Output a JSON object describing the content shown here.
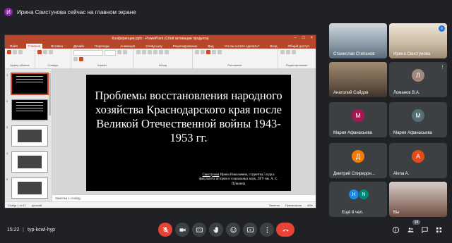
{
  "banner": {
    "avatar_letter": "И",
    "text": "Ирина Свистунова сейчас на главном экране",
    "avatar_color": "#8e24aa"
  },
  "ppt": {
    "window_title": "Конференция.pptx - PowerPoint (Сбой активации продукта)",
    "tabs": [
      "Файл",
      "Главная",
      "Вставка",
      "Дизайн",
      "Переходы",
      "Анимация",
      "Слайд-шоу",
      "Рецензирование",
      "Вид",
      "Что вы хотите сделать?",
      "Вход",
      "Общий доступ"
    ],
    "ribbon_groups": [
      "Буфер обмена",
      "Слайды",
      "Шрифт",
      "Абзац",
      "Рисование",
      "Редактирование"
    ],
    "slide_title": "Проблемы восстановления народного хозяйства Краснодарского края после Великой Отечественной войны 1943-1953 гг.",
    "slide_author_name": "Свистунова",
    "slide_author_rest": " Ирина Николаевна, студентка 5 курса факультета истории и социальных наук, ЛГУ им. А. С. Пушкина",
    "thumb_numbers": [
      "1",
      "2",
      "3",
      "4",
      "5",
      "6"
    ],
    "notes_placeholder": "Заметки к слайду",
    "status_slide": "Слайд 1 из 11",
    "status_lang": "русский",
    "status_notes": "Заметки",
    "status_comments": "Примечания",
    "status_zoom": "49%"
  },
  "participants": [
    {
      "name": "Станислав Степанов",
      "type": "video",
      "color": "#8a9aa8"
    },
    {
      "name": "Ирина Свистунова",
      "type": "video",
      "color": "#c7b9a3",
      "speaking": true
    },
    {
      "name": "Анатолий Сайдов",
      "type": "video",
      "color": "#6b5a4a"
    },
    {
      "name": "Ломанов В.А.",
      "type": "avatar",
      "letter": "Л",
      "color": "#a1887f"
    },
    {
      "name": "Мария Афанасьева",
      "type": "avatar",
      "letter": "М",
      "color": "#ad1457"
    },
    {
      "name": "Мария Афанасьева",
      "type": "avatar",
      "letter": "М",
      "color": "#546e7a"
    },
    {
      "name": "Дмитрий Спиридон...",
      "type": "avatar",
      "letter": "Д",
      "color": "#f57c00"
    },
    {
      "name": "Alena A.",
      "type": "avatar",
      "letter": "A",
      "color": "#e64a19"
    },
    {
      "name": "Ещё 8 чел.",
      "type": "more",
      "letters": [
        "H",
        "N"
      ],
      "colors": [
        "#1e88e5",
        "#00897b"
      ]
    },
    {
      "name": "Вы",
      "type": "video",
      "color": "#8d6e63"
    }
  ],
  "bottom": {
    "time": "15:22",
    "separator": "|",
    "meeting_code": "typ-kcwl-hyp",
    "participants_count": "18"
  }
}
